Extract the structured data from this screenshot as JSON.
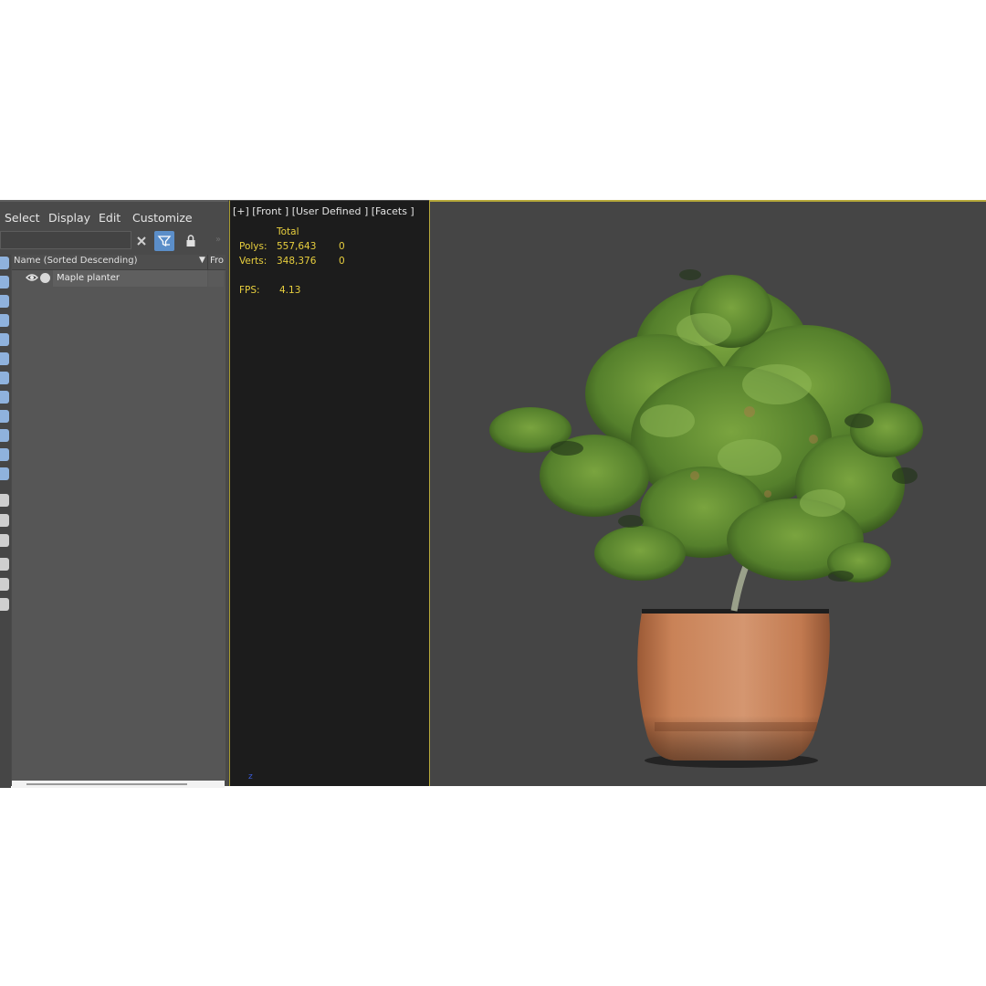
{
  "menu": {
    "select": "Select",
    "display": "Display",
    "edit": "Edit",
    "customize": "Customize"
  },
  "explorer": {
    "search_value": "",
    "column_name": "Name (Sorted Descending)",
    "column_frozen": "Fro",
    "items": [
      {
        "label": "Maple planter"
      }
    ]
  },
  "stats_viewport": {
    "label": "[+] [Front ] [User Defined ] [Facets ]",
    "total_header": "Total",
    "polys_label": "Polys:",
    "polys_value": "557,643",
    "polys_selected": "0",
    "verts_label": "Verts:",
    "verts_value": "348,376",
    "verts_selected": "0",
    "fps_label": "FPS:",
    "fps_value": "4.13",
    "axis_label": "z"
  },
  "colors": {
    "accent_blue": "#5b8ec9",
    "viewport_border": "#b6a83a",
    "stats_text": "#e8cf3e",
    "pot": "#c98257",
    "foliage": "#5c8a2e"
  }
}
